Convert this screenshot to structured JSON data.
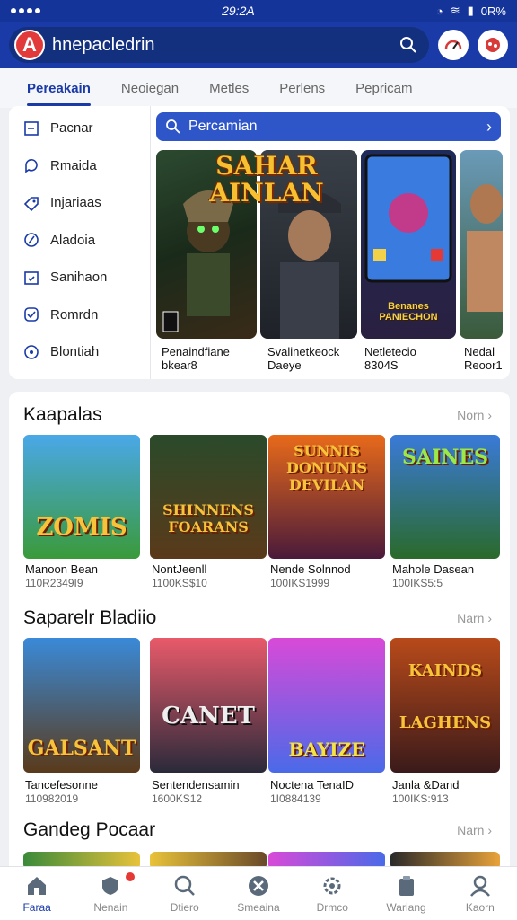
{
  "status": {
    "time": "29:2A",
    "battery": "0R%"
  },
  "appbar": {
    "title": "hnepacledrin"
  },
  "tabs": [
    "Pereakain",
    "Neoiegan",
    "Metles",
    "Perlens",
    "Pepricam"
  ],
  "sidebar": {
    "items": [
      {
        "label": "Pacnar",
        "icon": "book-icon"
      },
      {
        "label": "Rmaida",
        "icon": "chat-icon"
      },
      {
        "label": "Injariaas",
        "icon": "tag-icon"
      },
      {
        "label": "Aladoia",
        "icon": "compass-icon"
      },
      {
        "label": "Sanihaon",
        "icon": "calendar-icon"
      },
      {
        "label": "Romrdn",
        "icon": "check-icon"
      },
      {
        "label": "Blontiah",
        "icon": "info-icon"
      }
    ]
  },
  "subsearch": {
    "text": "Percamian"
  },
  "featured": {
    "banner": "SAHAR AINLAN",
    "items": [
      {
        "caption1": "Penaindfiane",
        "caption2": "bkear8"
      },
      {
        "caption1": "Svalinetkeock",
        "caption2": "Daeye"
      },
      {
        "caption1": "Netletecio",
        "caption2": "8304S",
        "banner": "Benanes PANIECHON"
      },
      {
        "caption1": "Nedal",
        "caption2": "Reoor1"
      }
    ]
  },
  "sections": [
    {
      "title": "Kaapalas",
      "more": "Norn",
      "cards": [
        {
          "art": "ZOMIS",
          "title": "Manoon Bean",
          "sub": "110R2349I9"
        },
        {
          "art": "SHINNENS FOARANS",
          "title": "NontJeenll",
          "sub": "1100KS$10"
        },
        {
          "art": "SUNNIS DONUNIS DEVILAN",
          "title": "Nende Solnnod",
          "sub": "100IKS1999"
        },
        {
          "art": "SAINES",
          "title": "Mahole Dasean",
          "sub": "100IKS5:5"
        }
      ]
    },
    {
      "title": "Saparelr Bladiio",
      "more": "Narn",
      "cards": [
        {
          "art": "GALSANT",
          "title": "Tancefesonne",
          "sub": "110982019"
        },
        {
          "art": "CANET",
          "title": "Sentendensamin",
          "sub": "1600KS12"
        },
        {
          "art": "BAYIZE",
          "title": "Noctena TenaID",
          "sub": "1I0884139"
        },
        {
          "art": "KAINDS LAGHENS",
          "title": "Janla &Dand",
          "sub": "100IKS:913"
        }
      ]
    },
    {
      "title": "Gandeg Pocaar",
      "more": "Narn"
    }
  ],
  "bottomnav": [
    {
      "label": "Faraa",
      "icon": "home-icon",
      "active": true
    },
    {
      "label": "Nenain",
      "icon": "shield-icon",
      "active": false
    },
    {
      "label": "Dtiero",
      "icon": "search-icon",
      "active": false
    },
    {
      "label": "Smeaina",
      "icon": "close-circle-icon",
      "active": false
    },
    {
      "label": "Drmco",
      "icon": "gear-icon",
      "active": false
    },
    {
      "label": "Wariang",
      "icon": "clipboard-icon",
      "active": false
    },
    {
      "label": "Kaorn",
      "icon": "profile-icon",
      "active": false
    }
  ],
  "colors": {
    "primary": "#1a3aa8",
    "accent": "#e23a3a",
    "background": "#eef0f4"
  }
}
